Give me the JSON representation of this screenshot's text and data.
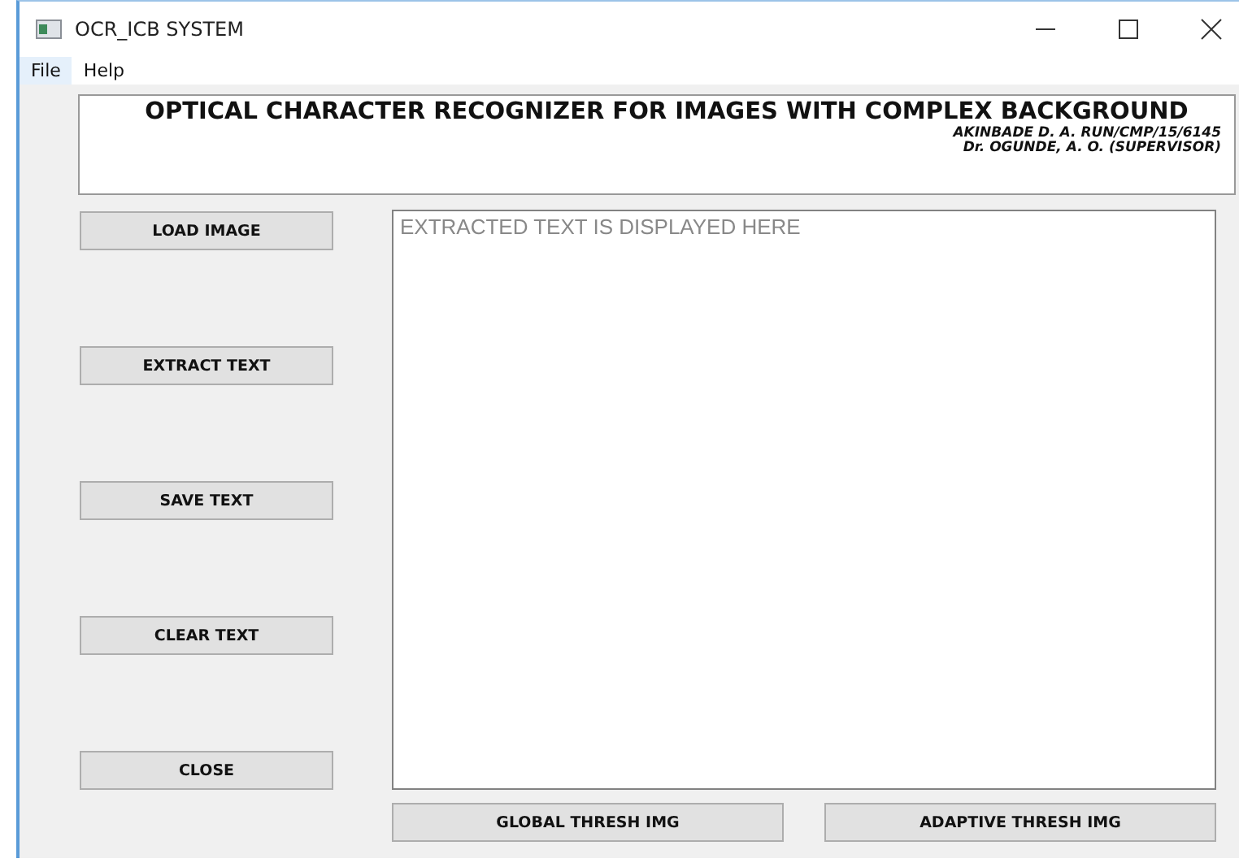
{
  "window": {
    "title": "OCR_ICB SYSTEM"
  },
  "menu": [
    "File",
    "Help"
  ],
  "header": {
    "title": "OPTICAL CHARACTER RECOGNIZER FOR IMAGES WITH COMPLEX BACKGROUND",
    "credits": [
      "AKINBADE D. A. RUN/CMP/15/6145",
      "Dr. OGUNDE, A. O. (SUPERVISOR)"
    ]
  },
  "side_buttons": [
    "LOAD IMAGE",
    "EXTRACT TEXT",
    "SAVE TEXT",
    "CLEAR TEXT",
    "CLOSE"
  ],
  "output": {
    "placeholder": "EXTRACTED TEXT IS DISPLAYED HERE"
  },
  "bottom_buttons": [
    "GLOBAL THRESH IMG",
    "ADAPTIVE THRESH IMG"
  ]
}
